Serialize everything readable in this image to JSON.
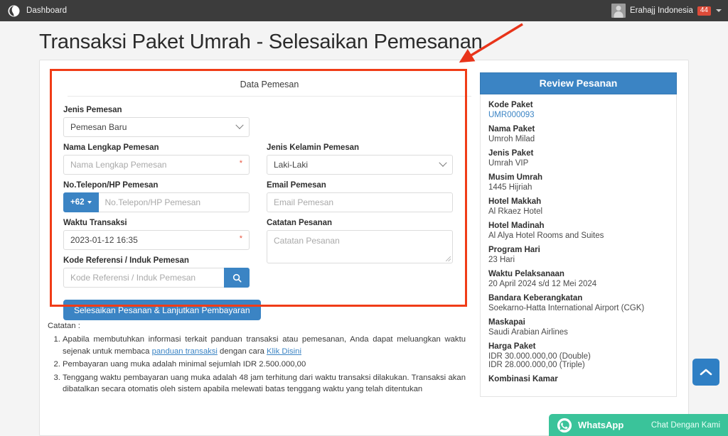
{
  "navbar": {
    "brand": "Dashboard",
    "brand_icon": "globe-icon",
    "user_name": "Erahajj Indonesia",
    "notification_count": "44",
    "caret_icon": "chevron-down-icon"
  },
  "page_title": "Transaksi Paket Umrah - Selesaikan Pemesanan",
  "form": {
    "panel_title": "Data Pemesan",
    "jenis_pemesan": {
      "label": "Jenis Pemesan",
      "value": "Pemesan Baru",
      "options": [
        "Pemesan Baru"
      ]
    },
    "nama_lengkap": {
      "label": "Nama Lengkap Pemesan",
      "placeholder": "Nama Lengkap Pemesan",
      "value": "",
      "required_mark": "*"
    },
    "jenis_kelamin": {
      "label": "Jenis Kelamin Pemesan",
      "value": "Laki-Laki",
      "options": [
        "Laki-Laki"
      ]
    },
    "telepon": {
      "label": "No.Telepon/HP Pemesan",
      "country_code": "+62",
      "placeholder": "No.Telepon/HP Pemesan",
      "value": ""
    },
    "email": {
      "label": "Email Pemesan",
      "placeholder": "Email Pemesan",
      "value": ""
    },
    "waktu_transaksi": {
      "label": "Waktu Transaksi",
      "value": "2023-01-12 16:35",
      "required_mark": "*"
    },
    "catatan_pesanan": {
      "label": "Catatan Pesanan",
      "placeholder": "Catatan Pesanan",
      "value": ""
    },
    "kode_referensi": {
      "label": "Kode Referensi / Induk Pemesan",
      "placeholder": "Kode Referensi / Induk Pemesan",
      "value": "",
      "search_icon": "search-icon"
    },
    "submit_label": "Selesaikan Pesanan & Lanjutkan Pembayaran"
  },
  "notes": {
    "title": "Catatan :",
    "items": [
      {
        "text_before": "Apabila membutuhkan informasi terkait panduan transaksi atau pemesanan, Anda dapat meluangkan waktu sejenak untuk membaca ",
        "link1": "panduan transaksi",
        "text_middle": " dengan cara ",
        "link2": "Klik Disini",
        "text_after": ""
      },
      {
        "text_before": "Pembayaran uang muka adalah minimal sejumlah IDR 2.500.000,00",
        "link1": "",
        "text_middle": "",
        "link2": "",
        "text_after": ""
      },
      {
        "text_before": "Tenggang waktu pembayaran uang muka adalah 48 jam terhitung dari waktu transaksi dilakukan. Transaksi akan dibatalkan secara otomatis oleh sistem apabila melewati batas tenggang waktu yang telah ditentukan",
        "link1": "",
        "text_middle": "",
        "link2": "",
        "text_after": ""
      }
    ]
  },
  "review": {
    "header": "Review Pesanan",
    "items": [
      {
        "label": "Kode Paket",
        "value": "UMR000093",
        "is_link": true
      },
      {
        "label": "Nama Paket",
        "value": "Umroh Milad",
        "is_link": false
      },
      {
        "label": "Jenis Paket",
        "value": "Umrah VIP",
        "is_link": false
      },
      {
        "label": "Musim Umrah",
        "value": "1445 Hijriah",
        "is_link": false
      },
      {
        "label": "Hotel Makkah",
        "value": "Al Rkaez Hotel",
        "is_link": false
      },
      {
        "label": "Hotel Madinah",
        "value": "Al Alya Hotel Rooms and Suites",
        "is_link": false
      },
      {
        "label": "Program Hari",
        "value": "23 Hari",
        "is_link": false
      },
      {
        "label": "Waktu Pelaksanaan",
        "value": "20 April 2024 s/d 12 Mei 2024",
        "is_link": false
      },
      {
        "label": "Bandara Keberangkatan",
        "value": "Soekarno-Hatta International Airport (CGK)",
        "is_link": false
      },
      {
        "label": "Maskapai",
        "value": "Saudi Arabian Airlines",
        "is_link": false
      },
      {
        "label": "Harga Paket",
        "value": "IDR 30.000.000,00  (Double)",
        "value2": "IDR 28.000.000,00  (Triple)",
        "is_link": false
      },
      {
        "label": "Kombinasi Kamar",
        "value": "",
        "is_link": false
      }
    ]
  },
  "floating": {
    "scroll_top_icon": "chevron-up-icon",
    "whatsapp_icon": "whatsapp-icon",
    "whatsapp_name": "WhatsApp",
    "whatsapp_cta": "Chat Dengan Kami"
  },
  "annotation": {
    "box_color": "#f03c17",
    "arrow_color": "#e8341a"
  },
  "colors": {
    "primary_blue": "#3b84c4",
    "navbar_dark": "#3c3c3c",
    "badge_red": "#dd4b39",
    "whatsapp_green": "#3ac39a",
    "link_blue": "#3b84c4"
  }
}
